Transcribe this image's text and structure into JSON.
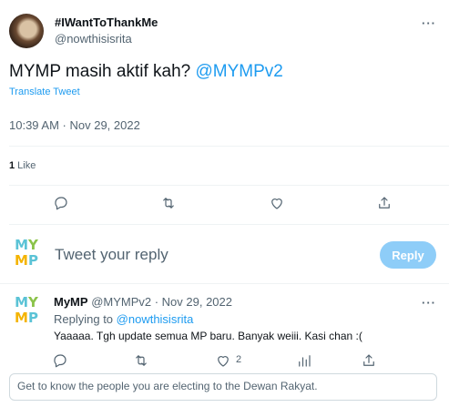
{
  "main_tweet": {
    "display_name": "#IWantToThankMe",
    "handle": "@nowthisisrita",
    "text": "MYMP masih aktif kah? ",
    "mention": "@MYMPv2",
    "translate_label": "Translate Tweet",
    "timestamp": "10:39 AM · Nov 29, 2022",
    "like_count": "1",
    "like_label": " Like",
    "more_icon": "···"
  },
  "compose": {
    "logo_top": [
      "M",
      "Y"
    ],
    "logo_bottom": [
      "M",
      "P"
    ],
    "placeholder": "Tweet your reply",
    "reply_button": "Reply"
  },
  "reply_tweet": {
    "display_name": "MyMP",
    "handle_and_date": "@MYMPv2 · Nov 29, 2022",
    "replying_prefix": "Replying to ",
    "replying_to": "@nowthisisrita",
    "text": "Yaaaaa. Tgh update semua MP baru. Banyak weiii. Kasi chan :(",
    "like_count": "2",
    "more_icon": "···"
  },
  "bio_snippet": "Get to know the people you are electing to the Dewan Rakyat.",
  "colors": {
    "accent": "#1d9bf0",
    "reply_button_disabled": "#8ecdf8",
    "muted_text": "#536471"
  }
}
